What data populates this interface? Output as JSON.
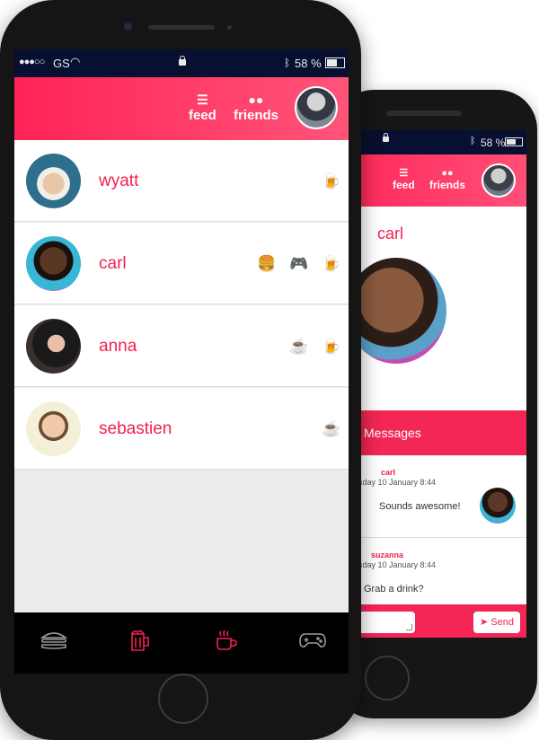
{
  "front": {
    "status": {
      "signal": "●●●○○",
      "carrier": "GS",
      "battery": "58 %"
    },
    "header": {
      "feed_label": "feed",
      "friends_label": "friends"
    },
    "friends": [
      {
        "name": "wyatt",
        "likes": [
          "🍺"
        ]
      },
      {
        "name": "carl",
        "likes": [
          "🍔",
          "🎮",
          "🍺"
        ]
      },
      {
        "name": "anna",
        "likes": [
          "☕",
          "🍺"
        ]
      },
      {
        "name": "sebastien",
        "likes": [
          "☕"
        ]
      }
    ],
    "tabs": [
      {
        "name": "burger-icon",
        "active": false
      },
      {
        "name": "beer-icon",
        "active": true
      },
      {
        "name": "coffee-icon",
        "active": true
      },
      {
        "name": "gamepad-icon",
        "active": false
      }
    ]
  },
  "back": {
    "status": {
      "battery": "58 %"
    },
    "header": {
      "feed_label": "feed",
      "friends_label": "friends"
    },
    "profile_name": "carl",
    "messages_title": "Messages",
    "messages": [
      {
        "author": "carl",
        "date": "sday 10 January 8:44",
        "text": "Sounds awesome!"
      },
      {
        "author": "suzanna",
        "date": "sday 10 January 8:44",
        "text": "Grab a drink?"
      }
    ],
    "send_label": "Send"
  },
  "colors": {
    "accent": "#f3214f",
    "status_bar": "#071030",
    "list_bg": "#ececec"
  }
}
